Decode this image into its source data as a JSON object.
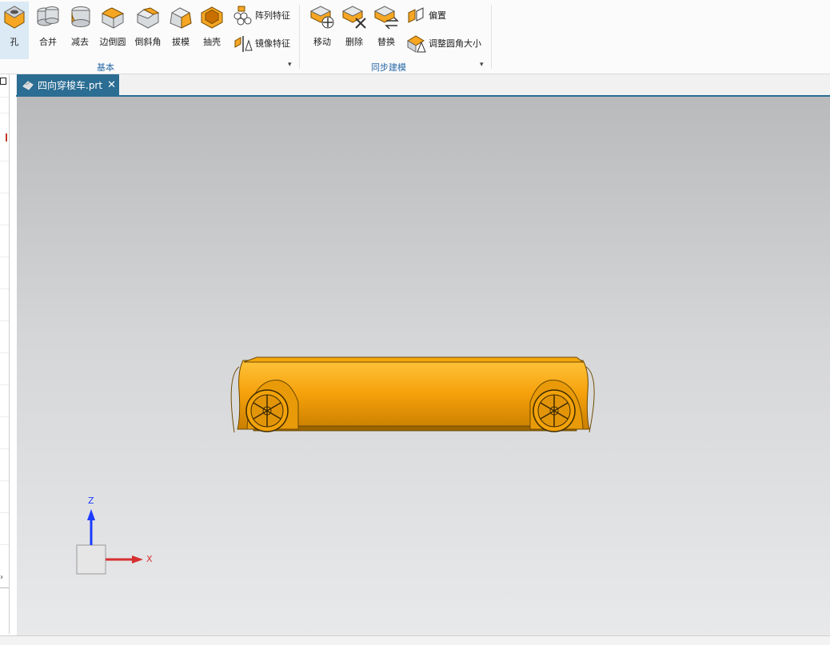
{
  "ribbon": {
    "buttons": [
      {
        "name": "hole-button",
        "label": "孔",
        "icon": "hole-icon"
      },
      {
        "name": "unite-button",
        "label": "合并",
        "icon": "unite-icon"
      },
      {
        "name": "subtract-button",
        "label": "减去",
        "icon": "subtract-icon"
      },
      {
        "name": "edge-blend-button",
        "label": "边倒圆",
        "icon": "edge-blend-icon"
      },
      {
        "name": "chamfer-button",
        "label": "倒斜角",
        "icon": "chamfer-icon"
      },
      {
        "name": "draft-button",
        "label": "拔模",
        "icon": "draft-icon"
      },
      {
        "name": "shell-button",
        "label": "抽壳",
        "icon": "shell-icon"
      }
    ],
    "small_buttons_basic": [
      {
        "label": "阵列特征",
        "icon": "pattern-feature-icon"
      },
      {
        "label": "镜像特征",
        "icon": "mirror-feature-icon"
      }
    ],
    "sync_buttons": [
      {
        "label": "移动",
        "icon": "move-face-icon"
      },
      {
        "label": "删除",
        "icon": "delete-face-icon"
      },
      {
        "label": "替换",
        "icon": "replace-face-icon"
      }
    ],
    "small_buttons_sync": [
      {
        "label": "偏置",
        "icon": "offset-face-icon"
      },
      {
        "label": "调整圆角大小",
        "icon": "resize-blend-icon"
      }
    ],
    "groups": {
      "basic": "基本",
      "sync": "同步建模"
    }
  },
  "tab": {
    "title": "四向穿梭车.prt",
    "icon": "part-file-icon",
    "close": "✕"
  },
  "triad": {
    "z": "Z",
    "x": "X"
  },
  "colors": {
    "accent": "#2b6d93",
    "model": "#f2a20a",
    "model_dark": "#b87806"
  }
}
